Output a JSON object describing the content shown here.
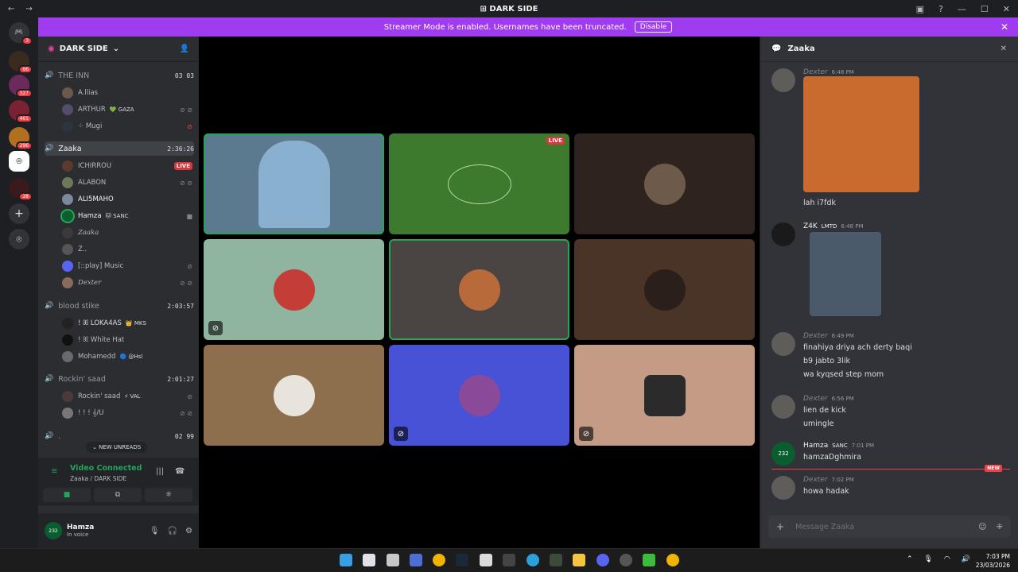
{
  "titlebar": {
    "title": "DARK SIDE",
    "back": "←",
    "forward": "→",
    "min": "—",
    "max": "☐",
    "close": "✕",
    "inbox": "▣",
    "help": "?"
  },
  "banner": {
    "text": "Streamer Mode is enabled. Usernames have been truncated.",
    "button": "Disable",
    "close": "✕"
  },
  "rail": {
    "servers": [
      {
        "badge": "3"
      },
      {
        "badge": "66"
      },
      {
        "badge": "327"
      },
      {
        "badge": "461"
      },
      {
        "badge": "296"
      },
      {
        "badge": ""
      },
      {
        "badge": "28"
      }
    ]
  },
  "server": {
    "name": "DARK SIDE",
    "chevron": "⌄"
  },
  "channels": [
    {
      "name": "THE INN",
      "count": "03  03"
    },
    {
      "name": "Zaaka",
      "count": "2:36:26"
    },
    {
      "name": "blood stike",
      "count": "2:03:57"
    },
    {
      "name": "Rockin' saad",
      "count": "2:01:27"
    },
    {
      "name": ".",
      "count": "02  99"
    }
  ],
  "users": {
    "inn": [
      {
        "name": "A.llias",
        "tag": ""
      },
      {
        "name": "ARTHUR",
        "tag": "💚 GAZA"
      },
      {
        "name": "⁘ Mugi",
        "tag": ""
      }
    ],
    "zaaka": [
      {
        "name": "ICHIRROU",
        "tag": "",
        "live": "LIVE"
      },
      {
        "name": "ALABON",
        "tag": ""
      },
      {
        "name": "ALI5MAHO",
        "tag": ""
      },
      {
        "name": "Hamza",
        "tag": "🐱 SANC"
      },
      {
        "name": "Zaaka",
        "tag": ""
      },
      {
        "name": "Z..",
        "tag": ""
      },
      {
        "name": "[::play] Music",
        "tag": ""
      },
      {
        "name": "Dexter",
        "tag": ""
      }
    ],
    "blood": [
      {
        "name": "! ꕤ LOKA4AS",
        "tag": "👑 MKS"
      },
      {
        "name": "! ꕤ White Hat",
        "tag": ""
      },
      {
        "name": "Mohamedd",
        "tag": "🔵 @Hsl"
      }
    ],
    "rockin": [
      {
        "name": "Rockin' saad",
        "tag": "⚡ VAL"
      },
      {
        "name": "! ! !  𝄞/U",
        "tag": ""
      }
    ]
  },
  "new_unreads": "⌄  NEW UNREADS",
  "rtc": {
    "status": "Video Connected",
    "sub": "Zaaka / DARK SIDE"
  },
  "user_panel": {
    "name": "Hamza",
    "status": "In voice",
    "avatar_text": "232"
  },
  "stage": {
    "tiles": [
      {
        "label": "webcam",
        "bg": "#5b7a8f"
      },
      {
        "label": "stream",
        "bg": "#3d7a2e",
        "live": "LIVE"
      },
      {
        "label": "user3",
        "bg": "#2e231f"
      },
      {
        "label": "user4",
        "bg": "#8fb5a0"
      },
      {
        "label": "user5",
        "bg": "#4a4442"
      },
      {
        "label": "user6",
        "bg": "#4a3427"
      },
      {
        "label": "user7",
        "bg": "#8d6f4d"
      },
      {
        "label": "user8",
        "bg": "#4752d6"
      },
      {
        "label": "user9",
        "bg": "#c49b84"
      }
    ]
  },
  "chat": {
    "title": "Zaaka",
    "messages": [
      {
        "author": "Dexter",
        "time": "6:48 PM",
        "lines": [
          "lah i7fdk"
        ],
        "avatar_color": "#5e5d5a"
      },
      {
        "author": "Z4K",
        "tag": "LMTD",
        "time": "6:48 PM",
        "lines": [],
        "avatar_color": "#1a1a1a"
      },
      {
        "author": "Dexter",
        "time": "6:49 PM",
        "lines": [
          "finahiya driya ach derty baqi",
          "b9 jabto 3lik",
          "wa kyqsed step mom"
        ],
        "avatar_color": "#5e5d5a"
      },
      {
        "author": "Dexter",
        "time": "6:56 PM",
        "lines": [
          "lien de kick",
          "umingle"
        ],
        "avatar_color": "#5e5d5a"
      },
      {
        "author": "Hamza",
        "tag": "SANC",
        "time": "7:01 PM",
        "lines": [
          "hamzaDghmira"
        ],
        "avatar_color": "#0a5d2e",
        "avatar_text": "232"
      },
      {
        "author": "Dexter",
        "time": "7:02 PM",
        "lines": [
          "howa hadak"
        ],
        "avatar_color": "#5e5d5a"
      }
    ],
    "new_tag": "NEW",
    "composer_placeholder": "Message Zaaka"
  },
  "taskbar": {
    "time": "7:03 PM",
    "date": "23/03/2026"
  }
}
